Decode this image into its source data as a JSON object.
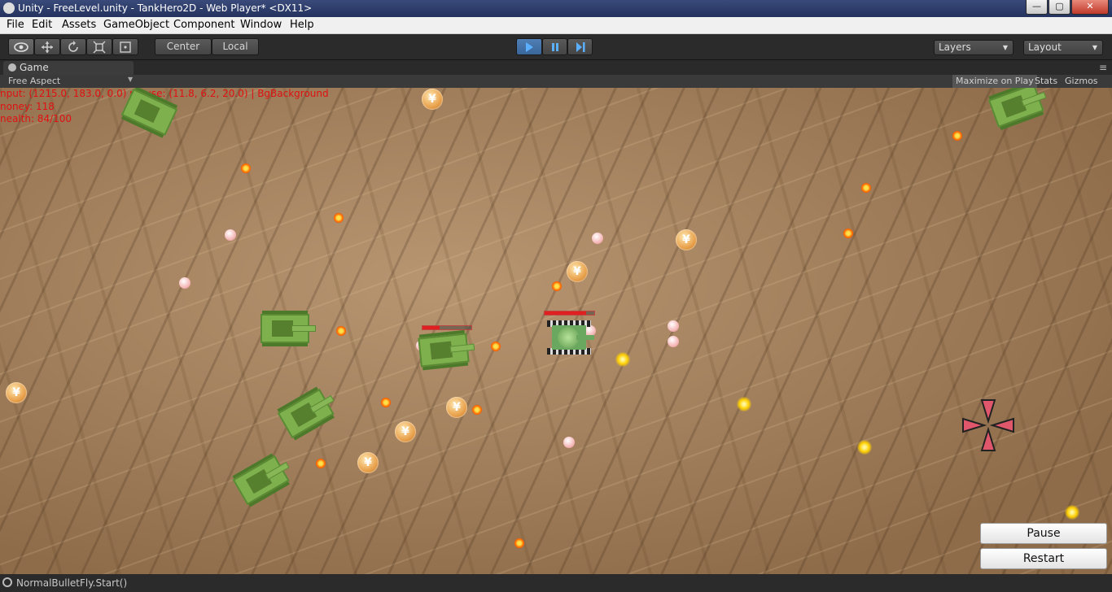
{
  "window": {
    "title": "Unity - FreeLevel.unity - TankHero2D - Web Player* <DX11>",
    "minimize": "—",
    "maximize": "▢",
    "close": "✕"
  },
  "menu": [
    "File",
    "Edit",
    "Assets",
    "GameObject",
    "Component",
    "Window",
    "Help"
  ],
  "toolbar": {
    "pivot_label": "Center",
    "space_label": "Local",
    "layers_label": "Layers",
    "layout_label": "Layout",
    "icons": [
      "eye-icon",
      "move-icon",
      "rotate-icon",
      "scale-icon",
      "rect-icon",
      "play-icon",
      "pause-icon",
      "step-icon"
    ]
  },
  "game_tab": {
    "label": "Game",
    "aspect": "Free Aspect",
    "maximize_on_play": "Maximize on Play",
    "stats": "Stats",
    "gizmos": "Gizmos"
  },
  "debug_lines": [
    "nput: (1215.0, 183.0, 0.0) mouse: (11.8, 6.2, 20.0) | BgBackground",
    "noney: 118",
    "nealth: 84/100"
  ],
  "coin_symbol": "¥",
  "player_health_fraction": 0.84,
  "enemy_health_fraction": 0.35,
  "controls": {
    "pause": "Pause",
    "restart": "Restart"
  },
  "status": {
    "message": "NormalBulletFly.Start()"
  },
  "colors": {
    "debug_text": "#e01010",
    "play_active": "#4f7fb5",
    "tank_green": "#7fb04e"
  }
}
